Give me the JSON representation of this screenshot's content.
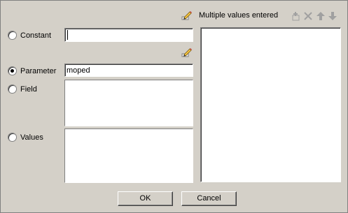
{
  "header": {
    "status_text": "Multiple values entered"
  },
  "options": {
    "constant": {
      "label": "Constant",
      "value": "",
      "selected": false
    },
    "parameter": {
      "label": "Parameter",
      "value": "moped",
      "selected": true
    },
    "field": {
      "label": "Field",
      "selected": false
    },
    "values": {
      "label": "Values",
      "selected": false
    }
  },
  "buttons": {
    "ok": "OK",
    "cancel": "Cancel"
  },
  "icons": {
    "edit": "pencil-edit-icon",
    "add": "add-icon",
    "delete": "delete-x-icon",
    "move_up": "arrow-up-icon",
    "move_down": "arrow-down-icon"
  }
}
